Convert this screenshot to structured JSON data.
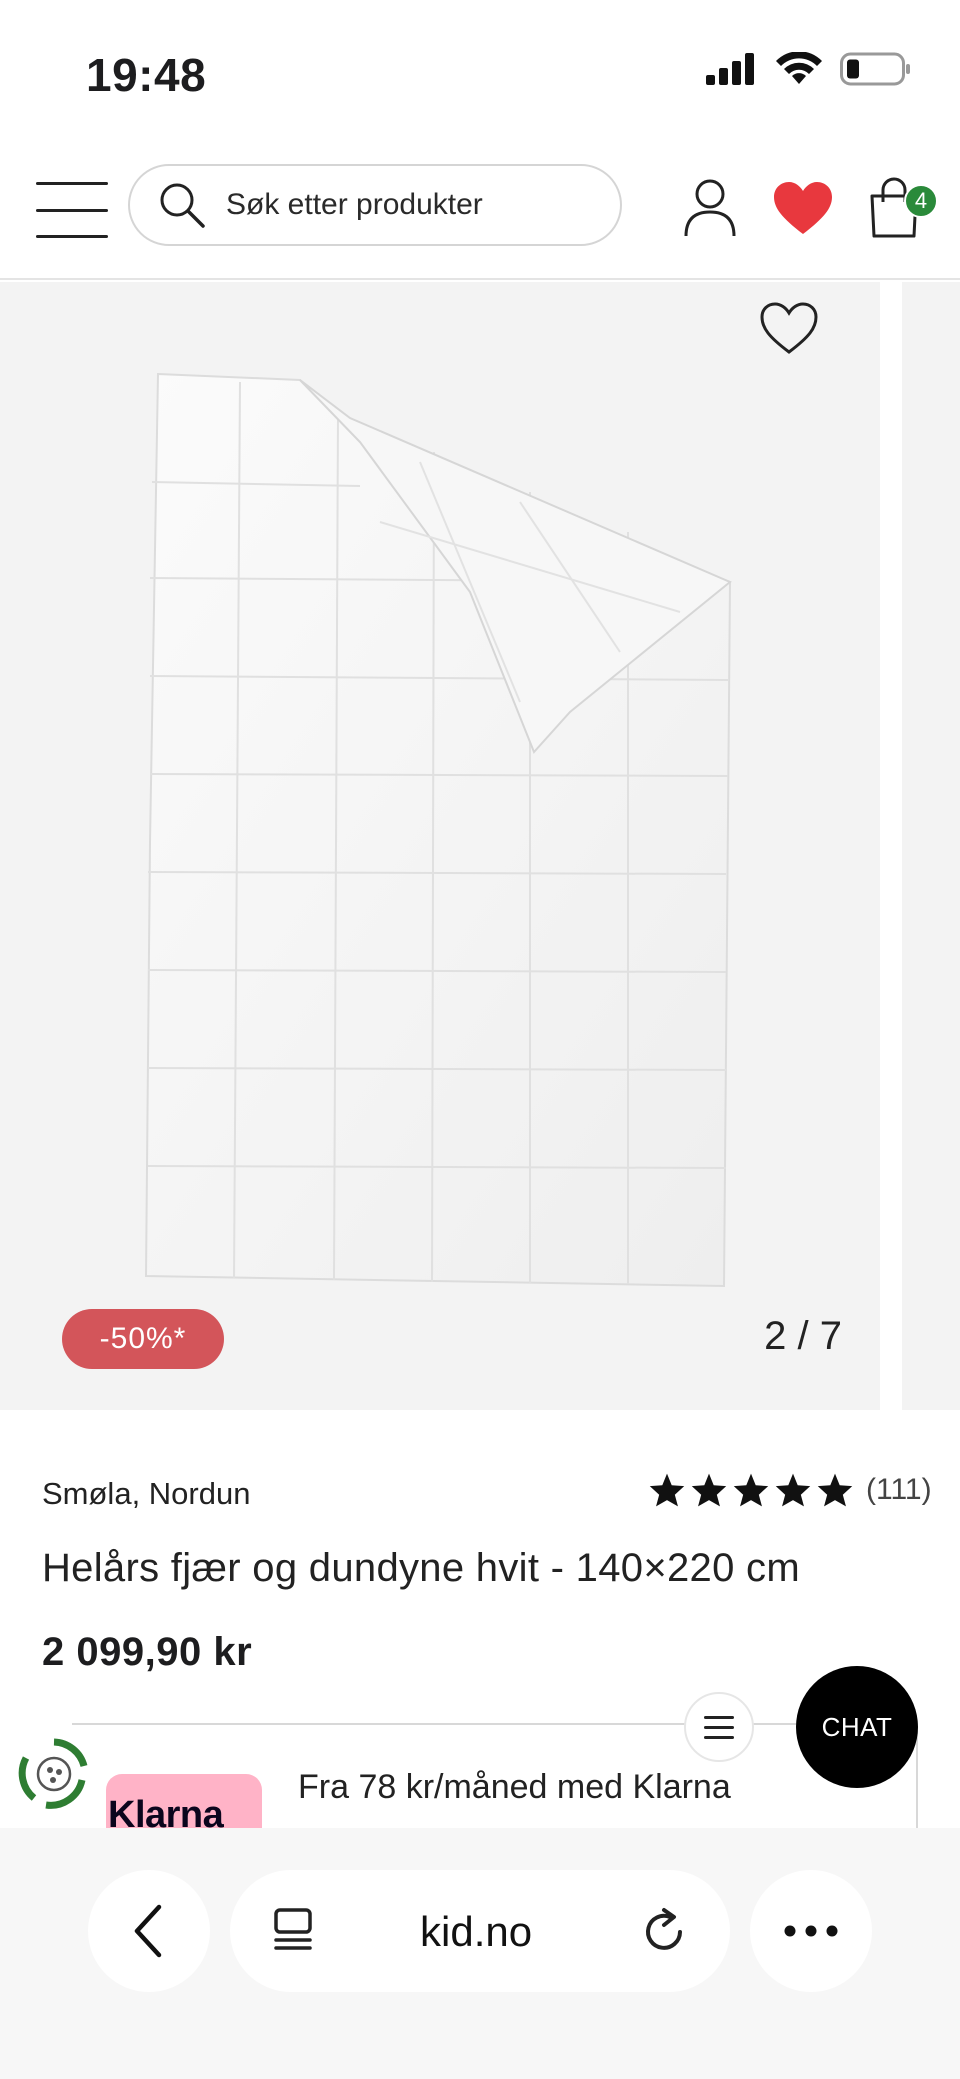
{
  "status_bar": {
    "time": "19:48"
  },
  "header": {
    "search_placeholder": "Søk etter produkter",
    "cart_count": "4"
  },
  "gallery": {
    "discount_label": "-50%*",
    "image_counter": "2 / 7"
  },
  "product": {
    "brand": "Smøla, Nordun",
    "rating_stars": 5,
    "rating_count": "(111)",
    "title": "Helårs fjær og dundyne hvit - 140×220 cm",
    "price": "2 099,90 kr"
  },
  "chat": {
    "label": "CHAT"
  },
  "payment": {
    "klarna_logo_text": "Klarna",
    "klarna_offer": "Fra 78 kr/måned med Klarna"
  },
  "browser": {
    "url": "kid.no"
  },
  "colors": {
    "discount_red": "#d3555a",
    "heart_red": "#e8383e",
    "cart_badge_green": "#2a8a3a",
    "klarna_pink": "#ffb3c7",
    "gallery_bg": "#f3f3f3"
  }
}
